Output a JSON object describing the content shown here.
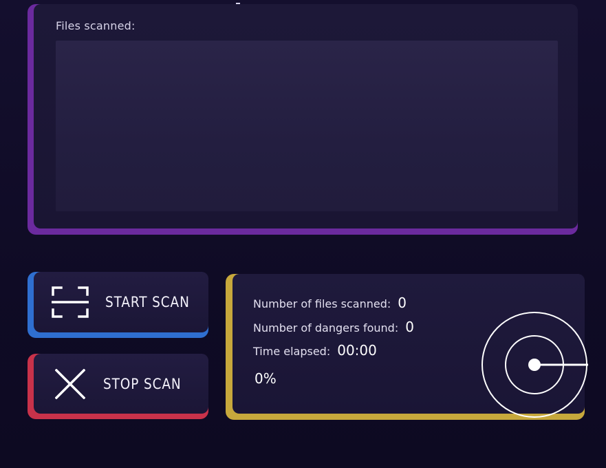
{
  "files_panel": {
    "label": "Files scanned:",
    "accent": "#6b2a9e"
  },
  "buttons": {
    "start": {
      "label": "START SCAN",
      "icon": "scan-frame-icon",
      "accent": "#2f6fd0"
    },
    "stop": {
      "label": "STOP SCAN",
      "icon": "close-x-icon",
      "accent": "#c8324a"
    }
  },
  "stats": {
    "accent": "#c7a83c",
    "files_scanned_label": "Number of files scanned:",
    "files_scanned_value": "0",
    "dangers_found_label": "Number of dangers found:",
    "dangers_found_value": "0",
    "time_elapsed_label": "Time elapsed:",
    "time_elapsed_value": "00:00",
    "progress": "0%",
    "radar_icon": "radar-icon"
  }
}
